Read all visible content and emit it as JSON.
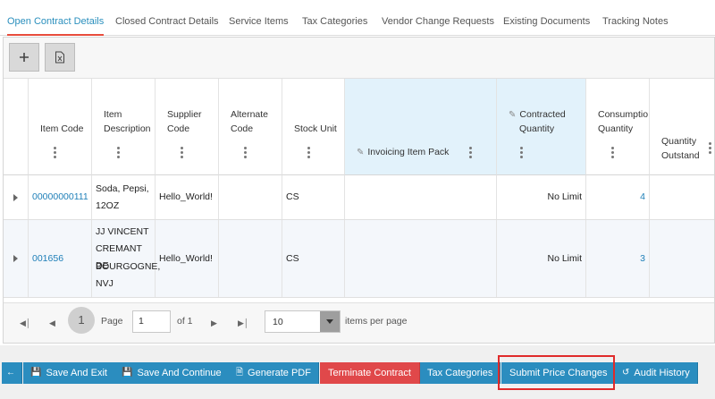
{
  "tabs": [
    {
      "label": "Open Contract Details",
      "active": true
    },
    {
      "label": "Closed Contract Details",
      "active": false
    },
    {
      "label": "Service Items",
      "active": false
    },
    {
      "label": "Tax Categories",
      "active": false
    },
    {
      "label": "Vendor Change Requests",
      "active": false
    },
    {
      "label": "Existing Documents",
      "active": false
    },
    {
      "label": "Tracking Notes",
      "active": false
    }
  ],
  "toolbar": {
    "add_icon": "plus-icon",
    "export_icon": "excel-export-icon"
  },
  "columns": [
    {
      "line1": "",
      "line2": "Item Code"
    },
    {
      "line1": "Item",
      "line2": "Description"
    },
    {
      "line1": "Supplier",
      "line2": "Code"
    },
    {
      "line1": "Alternate",
      "line2": "Code"
    },
    {
      "line1": "",
      "line2": "Stock Unit"
    },
    {
      "line1": "",
      "line2": "Invoicing Item Pack",
      "editable": true
    },
    {
      "line1": "Contracted",
      "line2": "Quantity",
      "editable": true
    },
    {
      "line1": "Consumptio",
      "line2": "Quantity"
    },
    {
      "line1": "Quantity",
      "line2": "Outstand"
    }
  ],
  "rows": [
    {
      "item_code": "00000000111",
      "description": [
        "Soda, Pepsi,",
        "12OZ"
      ],
      "supplier_code": "Hello_World!",
      "alternate_code": "",
      "stock_unit": "CS",
      "invoicing_item_pack": "",
      "contracted_quantity": "No Limit",
      "consumption_quantity": "4",
      "quantity_outstanding": ""
    },
    {
      "item_code": "001656",
      "description": [
        "JJ VINCENT",
        "CREMANT DE",
        "BOURGOGNE,",
        "NVJ"
      ],
      "supplier_code": "Hello_World!",
      "alternate_code": "",
      "stock_unit": "CS",
      "invoicing_item_pack": "",
      "contracted_quantity": "No Limit",
      "consumption_quantity": "3",
      "quantity_outstanding": ""
    }
  ],
  "pager": {
    "current_page": "1",
    "page_label": "Page",
    "page_input": "1",
    "of_label": "of 1",
    "page_size": "10",
    "items_per_page_label": "items per page"
  },
  "actions": {
    "back_icon": "arrow-left-icon",
    "save_and_exit": "Save And Exit",
    "save_and_continue": "Save And Continue",
    "generate_pdf": "Generate PDF",
    "terminate_contract": "Terminate Contract",
    "tax_categories": "Tax Categories",
    "submit_price_changes": "Submit Price Changes",
    "audit_history": "Audit History"
  },
  "colors": {
    "accent": "#2b8dbf",
    "danger": "#e0484a",
    "active_tab_underline": "#e74c3c",
    "highlight_box": "#e02b2b"
  }
}
